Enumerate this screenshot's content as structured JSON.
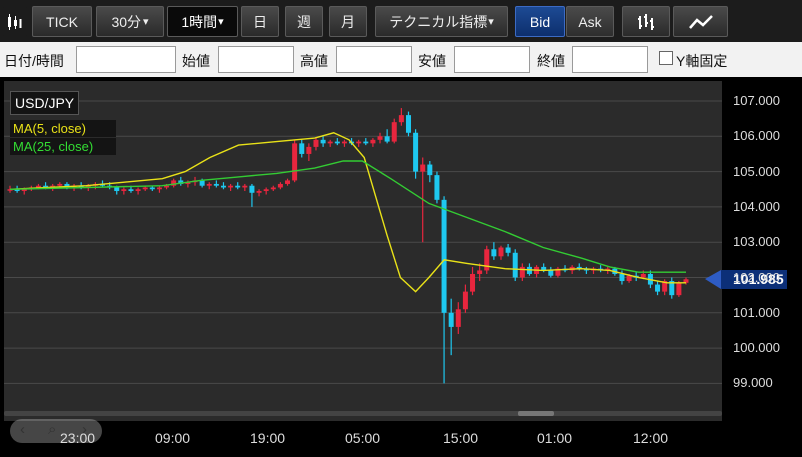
{
  "toolbar": {
    "chart_type_icon": "candlestick-icon",
    "tick": "TICK",
    "interval_30": "30分",
    "interval_30_arrow": "▾",
    "interval_1h": "1時間",
    "interval_1h_arrow": "▾",
    "day": "日",
    "week": "週",
    "month": "月",
    "technical": "テクニカル指標",
    "technical_arrow": "▾",
    "bid": "Bid",
    "ask": "Ask",
    "bar_icon": "bar-chart-icon",
    "line_icon": "line-chart-icon"
  },
  "ohlc": {
    "datetime_label": "日付/時間",
    "open_label": "始値",
    "high_label": "高値",
    "low_label": "安値",
    "close_label": "終値",
    "yaxis_fixed_label": "Y軸固定"
  },
  "chart": {
    "symbol": "USD/JPY",
    "ma5_label": "MA(5, close)",
    "ma25_label": "MA(25, close)",
    "current_price": "101.985",
    "colors": {
      "up": "#e8263e",
      "down": "#1ec8f0",
      "ma5": "#e9e218",
      "ma25": "#33cc33",
      "grid": "#4a4a4a",
      "bg": "#2b2b2b"
    }
  },
  "chart_data": {
    "type": "candlestick",
    "title": "",
    "y_ticks": [
      "107.000",
      "106.000",
      "105.000",
      "104.000",
      "103.000",
      "102.000",
      "101.000",
      "100.000",
      "99.000"
    ],
    "x_ticks": [
      "23:00",
      "09:00",
      "19:00",
      "05:00",
      "15:00",
      "01:00",
      "12:00"
    ],
    "ylim": [
      98.5,
      107.3
    ],
    "series": [
      {
        "name": "USD/JPY candles",
        "ohlc": [
          [
            104.5,
            104.6,
            104.4,
            104.5
          ],
          [
            104.5,
            104.6,
            104.4,
            104.45
          ],
          [
            104.45,
            104.55,
            104.35,
            104.5
          ],
          [
            104.5,
            104.6,
            104.45,
            104.55
          ],
          [
            104.55,
            104.65,
            104.5,
            104.6
          ],
          [
            104.6,
            104.7,
            104.5,
            104.55
          ],
          [
            104.55,
            104.65,
            104.45,
            104.6
          ],
          [
            104.6,
            104.7,
            104.55,
            104.65
          ],
          [
            104.65,
            104.7,
            104.5,
            104.55
          ],
          [
            104.55,
            104.65,
            104.45,
            104.6
          ],
          [
            104.6,
            104.7,
            104.5,
            104.55
          ],
          [
            104.55,
            104.65,
            104.45,
            104.6
          ],
          [
            104.6,
            104.7,
            104.5,
            104.65
          ],
          [
            104.65,
            104.75,
            104.55,
            104.6
          ],
          [
            104.6,
            104.7,
            104.5,
            104.55
          ],
          [
            104.55,
            104.6,
            104.35,
            104.45
          ],
          [
            104.45,
            104.55,
            104.35,
            104.5
          ],
          [
            104.5,
            104.6,
            104.4,
            104.45
          ],
          [
            104.45,
            104.55,
            104.35,
            104.5
          ],
          [
            104.5,
            104.6,
            104.45,
            104.55
          ],
          [
            104.55,
            104.6,
            104.45,
            104.5
          ],
          [
            104.5,
            104.6,
            104.4,
            104.55
          ],
          [
            104.55,
            104.65,
            104.5,
            104.6
          ],
          [
            104.6,
            104.8,
            104.55,
            104.75
          ],
          [
            104.75,
            104.85,
            104.6,
            104.65
          ],
          [
            104.65,
            104.75,
            104.55,
            104.7
          ],
          [
            104.7,
            104.85,
            104.6,
            104.75
          ],
          [
            104.75,
            104.8,
            104.55,
            104.6
          ],
          [
            104.6,
            104.7,
            104.5,
            104.65
          ],
          [
            104.65,
            104.75,
            104.55,
            104.6
          ],
          [
            104.6,
            104.7,
            104.5,
            104.55
          ],
          [
            104.55,
            104.65,
            104.45,
            104.6
          ],
          [
            104.6,
            104.7,
            104.5,
            104.55
          ],
          [
            104.55,
            104.65,
            104.45,
            104.6
          ],
          [
            104.6,
            104.65,
            104.0,
            104.4
          ],
          [
            104.4,
            104.5,
            104.3,
            104.45
          ],
          [
            104.45,
            104.55,
            104.35,
            104.5
          ],
          [
            104.5,
            104.6,
            104.45,
            104.55
          ],
          [
            104.55,
            104.7,
            104.5,
            104.65
          ],
          [
            104.65,
            104.8,
            104.6,
            104.75
          ],
          [
            104.75,
            105.9,
            104.7,
            105.8
          ],
          [
            105.8,
            105.9,
            105.4,
            105.5
          ],
          [
            105.5,
            105.8,
            105.3,
            105.7
          ],
          [
            105.7,
            105.95,
            105.6,
            105.9
          ],
          [
            105.9,
            106.0,
            105.7,
            105.8
          ],
          [
            105.8,
            105.9,
            105.7,
            105.85
          ],
          [
            105.85,
            105.95,
            105.75,
            105.8
          ],
          [
            105.8,
            105.9,
            105.7,
            105.85
          ],
          [
            105.85,
            105.95,
            105.75,
            105.8
          ],
          [
            105.8,
            105.9,
            105.7,
            105.85
          ],
          [
            105.85,
            105.95,
            105.75,
            105.8
          ],
          [
            105.8,
            105.95,
            105.7,
            105.9
          ],
          [
            105.9,
            106.1,
            105.8,
            106.0
          ],
          [
            106.0,
            106.2,
            105.8,
            105.85
          ],
          [
            105.85,
            106.5,
            105.8,
            106.4
          ],
          [
            106.4,
            106.8,
            106.3,
            106.6
          ],
          [
            106.6,
            106.7,
            106.0,
            106.1
          ],
          [
            106.1,
            106.2,
            104.8,
            105.0
          ],
          [
            105.0,
            105.4,
            103.0,
            105.2
          ],
          [
            105.2,
            105.3,
            104.7,
            104.9
          ],
          [
            104.9,
            105.0,
            104.1,
            104.2
          ],
          [
            104.2,
            104.3,
            99.0,
            101.0
          ],
          [
            101.0,
            101.4,
            99.8,
            100.6
          ],
          [
            100.6,
            101.3,
            100.4,
            101.1
          ],
          [
            101.1,
            101.8,
            101.0,
            101.6
          ],
          [
            101.6,
            102.3,
            101.5,
            102.1
          ],
          [
            102.1,
            102.4,
            101.9,
            102.2
          ],
          [
            102.2,
            102.9,
            102.1,
            102.8
          ],
          [
            102.8,
            103.0,
            102.5,
            102.6
          ],
          [
            102.6,
            102.9,
            102.5,
            102.85
          ],
          [
            102.85,
            102.95,
            102.6,
            102.7
          ],
          [
            102.7,
            102.8,
            101.9,
            102.0
          ],
          [
            102.0,
            102.4,
            101.9,
            102.3
          ],
          [
            102.3,
            102.4,
            102.05,
            102.1
          ],
          [
            102.1,
            102.35,
            102.0,
            102.3
          ],
          [
            102.3,
            102.4,
            102.15,
            102.2
          ],
          [
            102.2,
            102.3,
            102.0,
            102.05
          ],
          [
            102.05,
            102.3,
            102.0,
            102.25
          ],
          [
            102.25,
            102.35,
            102.15,
            102.2
          ],
          [
            102.2,
            102.35,
            102.1,
            102.3
          ],
          [
            102.3,
            102.4,
            102.2,
            102.25
          ],
          [
            102.25,
            102.3,
            102.1,
            102.2
          ],
          [
            102.2,
            102.3,
            102.1,
            102.25
          ],
          [
            102.25,
            102.35,
            102.15,
            102.2
          ],
          [
            102.2,
            102.3,
            102.1,
            102.25
          ],
          [
            102.25,
            102.3,
            102.05,
            102.1
          ],
          [
            102.1,
            102.2,
            101.8,
            101.9
          ],
          [
            101.9,
            102.1,
            101.85,
            102.05
          ],
          [
            102.05,
            102.15,
            101.9,
            102.0
          ],
          [
            102.0,
            102.2,
            101.95,
            102.1
          ],
          [
            102.1,
            102.2,
            101.7,
            101.8
          ],
          [
            101.8,
            101.9,
            101.5,
            101.6
          ],
          [
            101.6,
            101.95,
            101.5,
            101.9
          ],
          [
            101.9,
            102.0,
            101.4,
            101.5
          ],
          [
            101.5,
            101.9,
            101.45,
            101.85
          ],
          [
            101.85,
            102.0,
            101.8,
            101.95
          ]
        ]
      },
      {
        "name": "MA(5, close)",
        "values": [
          [
            0,
            104.5
          ],
          [
            20,
            104.55
          ],
          [
            40,
            104.6
          ],
          [
            60,
            104.7
          ],
          [
            80,
            104.8
          ],
          [
            92,
            105.0
          ],
          [
            105,
            105.4
          ],
          [
            120,
            105.75
          ],
          [
            140,
            105.85
          ],
          [
            160,
            105.95
          ],
          [
            170,
            106.1
          ],
          [
            178,
            105.9
          ],
          [
            186,
            105.4
          ],
          [
            192,
            104.3
          ],
          [
            198,
            103.2
          ],
          [
            205,
            102.0
          ],
          [
            213,
            101.6
          ],
          [
            220,
            102.0
          ],
          [
            228,
            102.5
          ],
          [
            240,
            102.4
          ],
          [
            260,
            102.25
          ],
          [
            280,
            102.2
          ],
          [
            300,
            102.25
          ],
          [
            315,
            102.2
          ],
          [
            330,
            102.0
          ],
          [
            345,
            101.85
          ],
          [
            355,
            101.85
          ]
        ]
      },
      {
        "name": "MA(25, close)",
        "values": [
          [
            0,
            104.5
          ],
          [
            40,
            104.55
          ],
          [
            80,
            104.6
          ],
          [
            100,
            104.75
          ],
          [
            120,
            104.85
          ],
          [
            140,
            104.95
          ],
          [
            160,
            105.1
          ],
          [
            175,
            105.3
          ],
          [
            185,
            105.3
          ],
          [
            200,
            104.8
          ],
          [
            220,
            104.1
          ],
          [
            240,
            103.7
          ],
          [
            260,
            103.3
          ],
          [
            280,
            102.85
          ],
          [
            300,
            102.55
          ],
          [
            315,
            102.3
          ],
          [
            330,
            102.15
          ],
          [
            345,
            102.15
          ],
          [
            355,
            102.15
          ]
        ]
      }
    ]
  }
}
